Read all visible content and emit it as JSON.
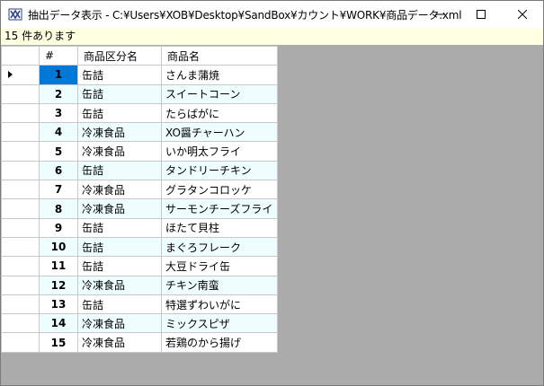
{
  "window": {
    "title": "抽出データ表示 - C:¥Users¥XOB¥Desktop¥SandBox¥カウント¥WORK¥商品データ.xml",
    "icon": "app-icon",
    "controls": [
      "minimize-icon",
      "maximize-icon",
      "close-icon"
    ]
  },
  "status": {
    "text": "15 件あります"
  },
  "grid": {
    "columns": [
      "#",
      "商品区分名",
      "商品名"
    ],
    "selected_row": 1,
    "rows": [
      {
        "num": "1",
        "category": "缶詰",
        "name": "さんま蒲焼"
      },
      {
        "num": "2",
        "category": "缶詰",
        "name": "スイートコーン"
      },
      {
        "num": "3",
        "category": "缶詰",
        "name": "たらばがに"
      },
      {
        "num": "4",
        "category": "冷凍食品",
        "name": "XO醤チャーハン"
      },
      {
        "num": "5",
        "category": "冷凍食品",
        "name": "いか明太フライ"
      },
      {
        "num": "6",
        "category": "缶詰",
        "name": "タンドリーチキン"
      },
      {
        "num": "7",
        "category": "冷凍食品",
        "name": "グラタンコロッケ"
      },
      {
        "num": "8",
        "category": "冷凍食品",
        "name": "サーモンチーズフライ"
      },
      {
        "num": "9",
        "category": "缶詰",
        "name": "ほたて貝柱"
      },
      {
        "num": "10",
        "category": "缶詰",
        "name": "まぐろフレーク"
      },
      {
        "num": "11",
        "category": "缶詰",
        "name": "大豆ドライ缶"
      },
      {
        "num": "12",
        "category": "冷凍食品",
        "name": "チキン南蛮"
      },
      {
        "num": "13",
        "category": "缶詰",
        "name": "特選ずわいがに"
      },
      {
        "num": "14",
        "category": "冷凍食品",
        "name": "ミックスピザ"
      },
      {
        "num": "15",
        "category": "冷凍食品",
        "name": "若鶏のから揚げ"
      }
    ]
  },
  "colors": {
    "selection": "#0078d7",
    "alt_row": "#eefeff",
    "status_bg": "#ffffe1",
    "empty_area": "#ababab"
  }
}
